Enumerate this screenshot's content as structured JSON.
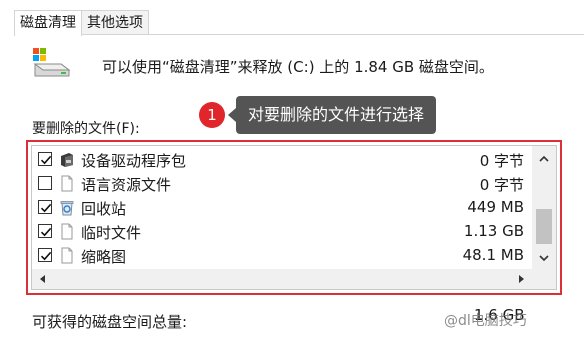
{
  "tabs": [
    {
      "label": "磁盘清理",
      "active": true
    },
    {
      "label": "其他选项",
      "active": false
    }
  ],
  "header": {
    "description": "可以使用“磁盘清理”来释放 (C:) 上的 1.84 GB 磁盘空间。",
    "icon": "drive-cleanup-icon"
  },
  "files_label": "要删除的文件(F):",
  "annotation": {
    "number": "1",
    "text": "对要删除的文件进行选择",
    "number_color": "#e0252b",
    "bubble_color": "#545454"
  },
  "highlight_color": "#dc3038",
  "file_list": [
    {
      "name": "设备驱动程序包",
      "size": "0 字节",
      "checked": true,
      "icon": "driver-package-icon"
    },
    {
      "name": "语言资源文件",
      "size": "0 字节",
      "checked": false,
      "icon": "file-icon"
    },
    {
      "name": "回收站",
      "size": "449 MB",
      "checked": true,
      "icon": "recycle-bin-icon"
    },
    {
      "name": "临时文件",
      "size": "1.13 GB",
      "checked": true,
      "icon": "file-icon"
    },
    {
      "name": "缩略图",
      "size": "48.1 MB",
      "checked": true,
      "icon": "file-icon"
    }
  ],
  "footer": {
    "total_label": "可获得的磁盘空间总量:",
    "total_value": "1.6 GB"
  },
  "watermark": "@dl电脑技巧"
}
